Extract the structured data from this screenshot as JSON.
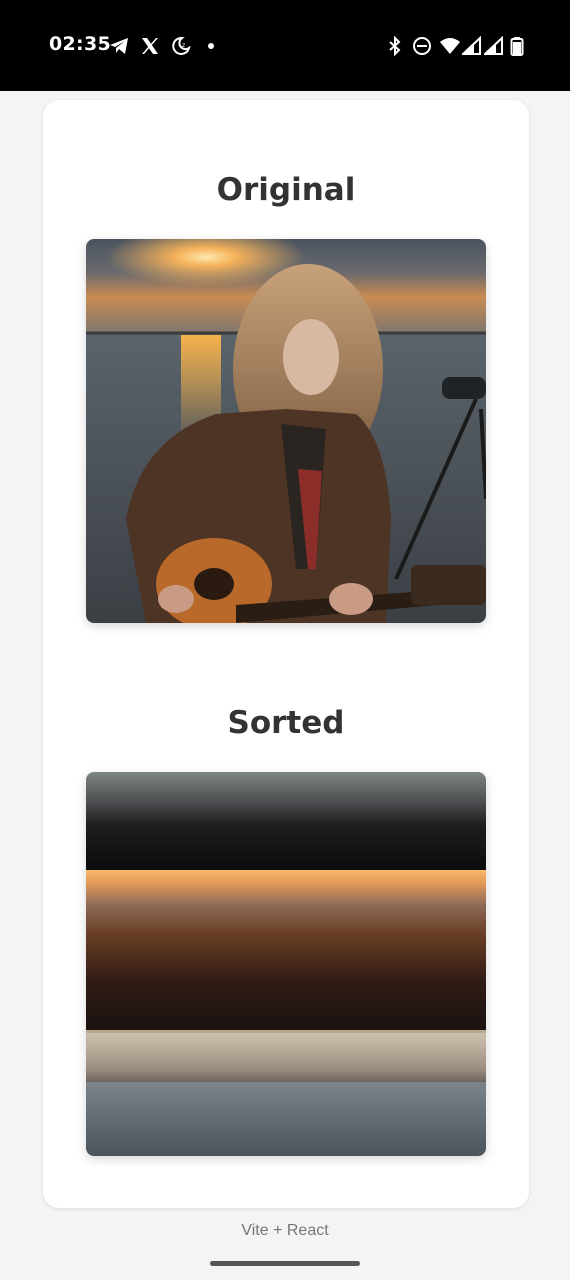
{
  "status_bar": {
    "time": "02:35",
    "left_icons": [
      "telegram-icon",
      "x-icon",
      "moon-icon",
      "dot-icon"
    ],
    "right_icons": [
      "bluetooth-icon",
      "do-not-disturb-icon",
      "wifi-icon",
      "signal-icon",
      "signal-icon",
      "battery-icon"
    ]
  },
  "card": {
    "original_heading": "Original",
    "sorted_heading": "Sorted"
  },
  "footer": {
    "text": "Vite + React"
  },
  "colors": {
    "page_background": "#f4f4f4",
    "card_background": "#ffffff",
    "heading_text": "#333333",
    "footer_text": "#777777"
  }
}
